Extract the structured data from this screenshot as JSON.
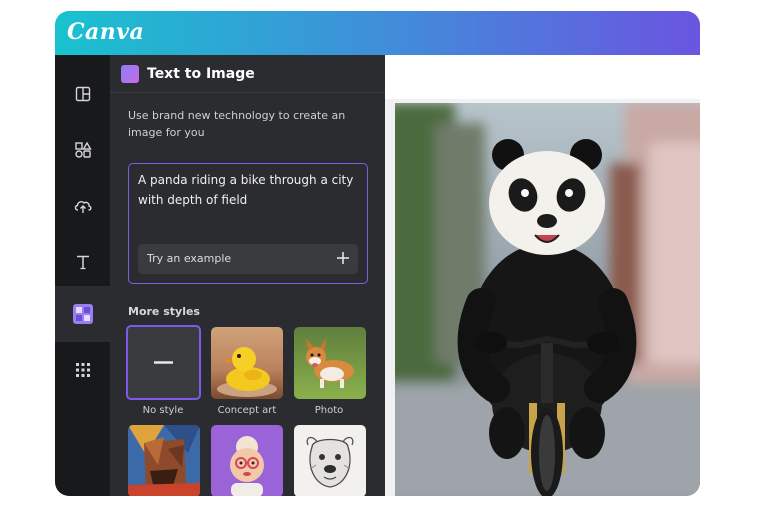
{
  "app": {
    "logo_text": "Canva"
  },
  "rail": {
    "items": [
      {
        "icon": "layout-icon"
      },
      {
        "icon": "elements-icon"
      },
      {
        "icon": "upload-icon"
      },
      {
        "icon": "text-icon"
      },
      {
        "icon": "text-to-image-app-icon",
        "active": true
      },
      {
        "icon": "apps-grid-icon"
      }
    ]
  },
  "panel": {
    "title": "Text to Image",
    "intro": "Use brand new technology to create an image for you",
    "prompt": "A panda riding a bike through a city with depth of field",
    "try_example_label": "Try an example",
    "styles_heading": "More styles",
    "styles": [
      {
        "label": "No style",
        "selected": true
      },
      {
        "label": "Concept art"
      },
      {
        "label": "Photo"
      },
      {
        "label": ""
      },
      {
        "label": ""
      },
      {
        "label": ""
      }
    ]
  },
  "colors": {
    "accent": "#7d5be6",
    "rail_bg": "#18191b",
    "panel_bg": "#2b2c2f"
  }
}
